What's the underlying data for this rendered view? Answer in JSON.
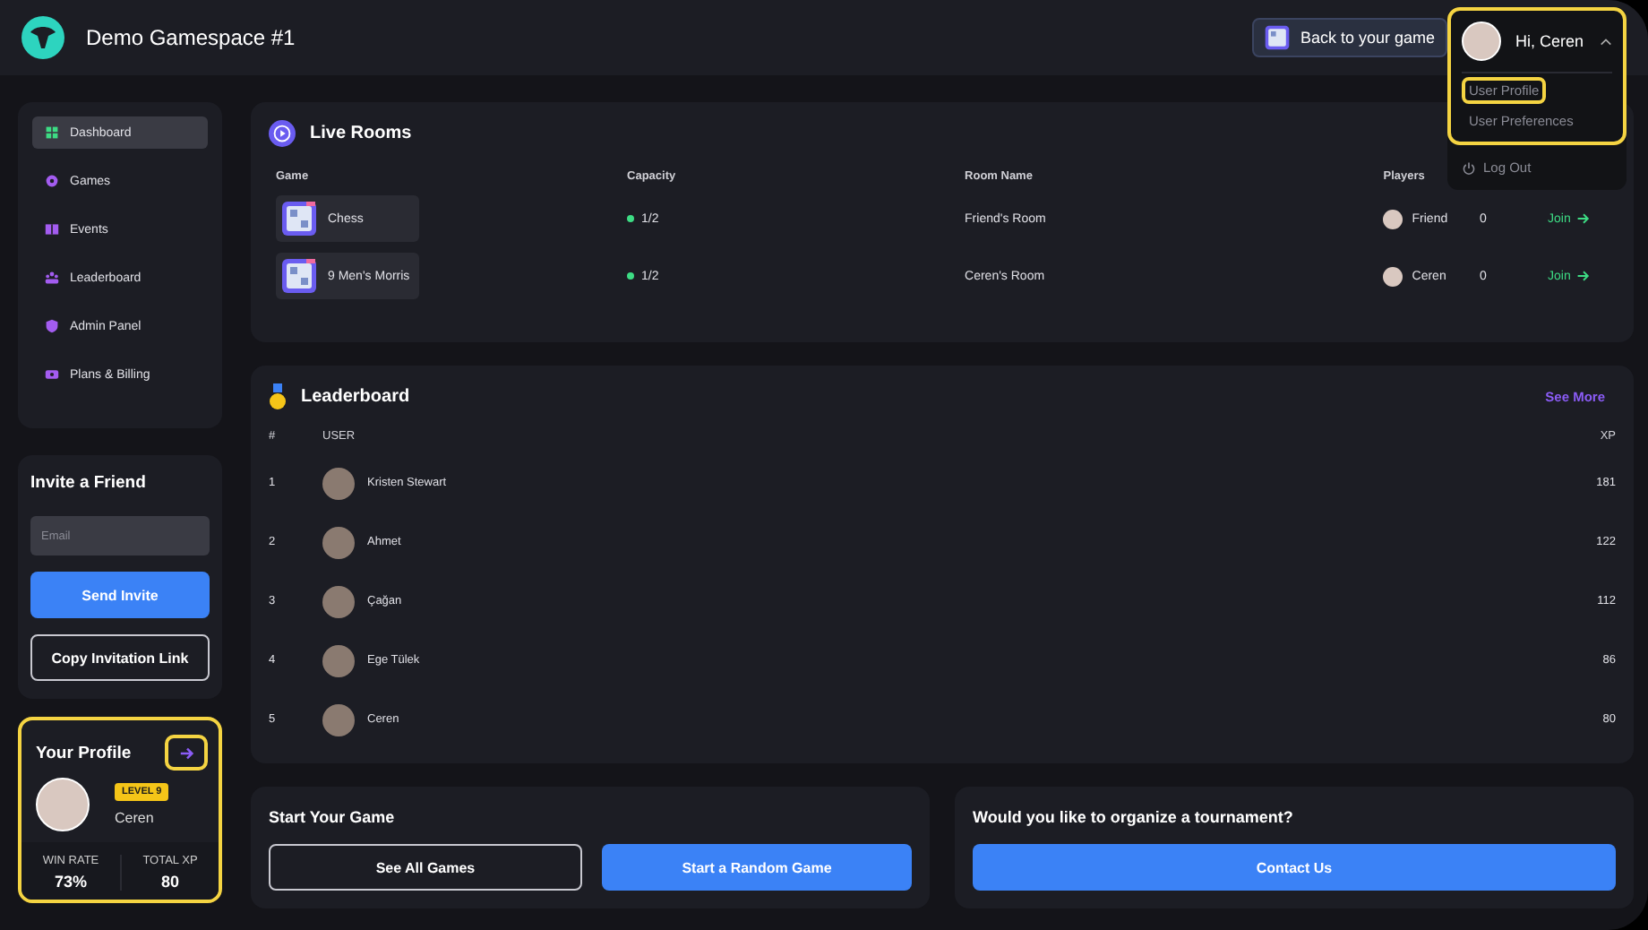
{
  "header": {
    "title": "Demo Gamespace #1",
    "back_button": "Back to your game"
  },
  "user_menu": {
    "greeting": "Hi, Ceren",
    "expanded": true,
    "highlighted": true,
    "items": [
      {
        "label": "User Profile",
        "highlighted": true
      },
      {
        "label": "User Preferences",
        "highlighted": false
      }
    ],
    "logout": "Log Out"
  },
  "sidebar": {
    "items": [
      {
        "label": "Dashboard",
        "selected": true
      },
      {
        "label": "Games",
        "selected": false
      },
      {
        "label": "Events",
        "selected": false
      },
      {
        "label": "Leaderboard",
        "selected": false
      },
      {
        "label": "Admin Panel",
        "selected": false
      },
      {
        "label": "Plans & Billing",
        "selected": false
      }
    ]
  },
  "invite": {
    "title": "Invite a Friend",
    "placeholder": "Email",
    "send": "Send Invite",
    "copy": "Copy Invitation Link"
  },
  "profile": {
    "title": "Your Profile",
    "highlighted": true,
    "arrow_highlighted": true,
    "level": "LEVEL 9",
    "name": "Ceren",
    "stats": [
      {
        "label": "WIN RATE",
        "value": "73%"
      },
      {
        "label": "TOTAL XP",
        "value": "80"
      }
    ]
  },
  "live_rooms": {
    "title": "Live Rooms",
    "columns": [
      "Game",
      "Capacity",
      "Room Name",
      "Players"
    ],
    "rows": [
      {
        "game": "Chess",
        "capacity": "1/2",
        "room": "Friend's Room",
        "player": "Friend",
        "count": "0",
        "action": "Join"
      },
      {
        "game": "9 Men's Morris",
        "capacity": "1/2",
        "room": "Ceren's Room",
        "player": "Ceren",
        "count": "0",
        "action": "Join"
      }
    ]
  },
  "leaderboard": {
    "title": "Leaderboard",
    "see_more": "See More",
    "columns": [
      "#",
      "USER",
      "XP"
    ],
    "rows": [
      {
        "rank": "1",
        "user": "Kristen Stewart",
        "xp": "181"
      },
      {
        "rank": "2",
        "user": "Ahmet",
        "xp": "122"
      },
      {
        "rank": "3",
        "user": "Çağan",
        "xp": "112"
      },
      {
        "rank": "4",
        "user": "Ege Tülek",
        "xp": "86"
      },
      {
        "rank": "5",
        "user": "Ceren",
        "xp": "80"
      }
    ]
  },
  "start_game": {
    "title": "Start Your Game",
    "secondary": "See All Games",
    "primary": "Start a Random Game"
  },
  "tournament": {
    "title": "Would you like to organize a tournament?",
    "button": "Contact Us"
  }
}
